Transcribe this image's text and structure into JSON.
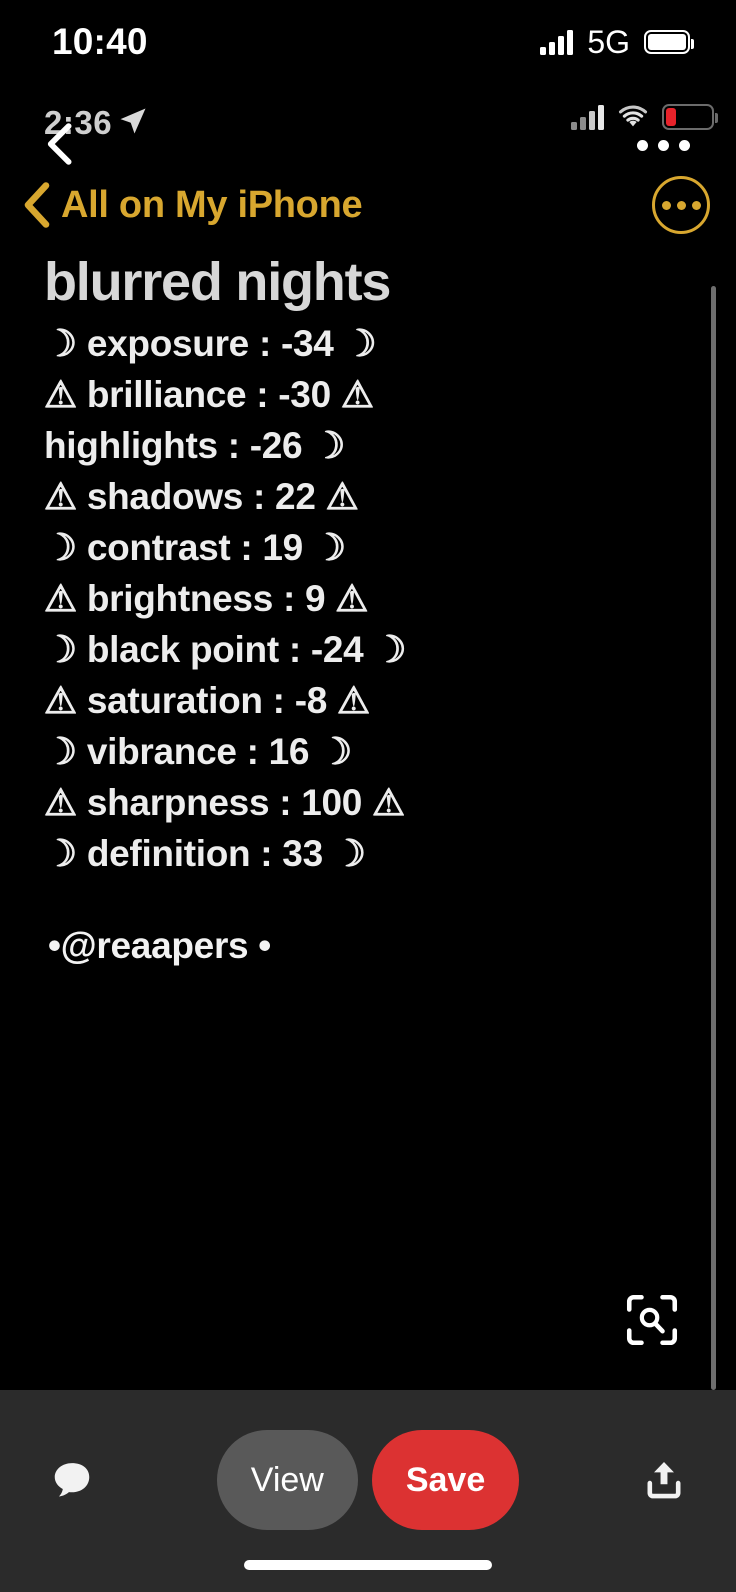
{
  "device_status": {
    "time": "10:40",
    "network_label": "5G",
    "signal_icon": "cellular-bars-icon",
    "battery_icon": "battery-full-icon"
  },
  "inner_status": {
    "time": "2:36",
    "location_icon": "location-arrow-icon",
    "signal_icon": "cellular-bars-icon",
    "wifi_icon": "wifi-icon",
    "battery_icon": "battery-low-icon",
    "overflow_dots": "three-dots-indicator"
  },
  "navbar": {
    "back_icon": "chevron-left-icon",
    "back_label": "All on My iPhone",
    "more_icon": "ellipsis-circle-icon",
    "accent_color": "#d8a72f"
  },
  "note": {
    "title": "blurred nights",
    "lines": [
      "☽ exposure : -34 ☽",
      "⚠ brilliance : -30 ⚠",
      "highlights : -26 ☽",
      "⚠ shadows : 22 ⚠",
      "☽ contrast : 19 ☽",
      "⚠ brightness : 9 ⚠",
      "☽ black point : -24 ☽",
      "⚠ saturation : -8 ⚠",
      "☽ vibrance : 16 ☽",
      "⚠ sharpness : 100 ⚠",
      "☽ definition : 33 ☽"
    ],
    "credit": "•@reaapers •",
    "settings": [
      {
        "name": "exposure",
        "value": "-34"
      },
      {
        "name": "brilliance",
        "value": "-30"
      },
      {
        "name": "highlights",
        "value": "-26"
      },
      {
        "name": "shadows",
        "value": "22"
      },
      {
        "name": "contrast",
        "value": "19"
      },
      {
        "name": "brightness",
        "value": "9"
      },
      {
        "name": "black point",
        "value": "-24"
      },
      {
        "name": "saturation",
        "value": "-8"
      },
      {
        "name": "vibrance",
        "value": "16"
      },
      {
        "name": "sharpness",
        "value": "100"
      },
      {
        "name": "definition",
        "value": "33"
      }
    ]
  },
  "livetext": {
    "icon": "live-text-scan-icon"
  },
  "toolbar": {
    "comment_icon": "speech-bubble-icon",
    "view_label": "View",
    "save_label": "Save",
    "share_icon": "share-export-icon",
    "view_color": "#595959",
    "save_color": "#dc3232",
    "background_color": "#2b2b2b"
  },
  "home_indicator": "home-indicator-bar"
}
